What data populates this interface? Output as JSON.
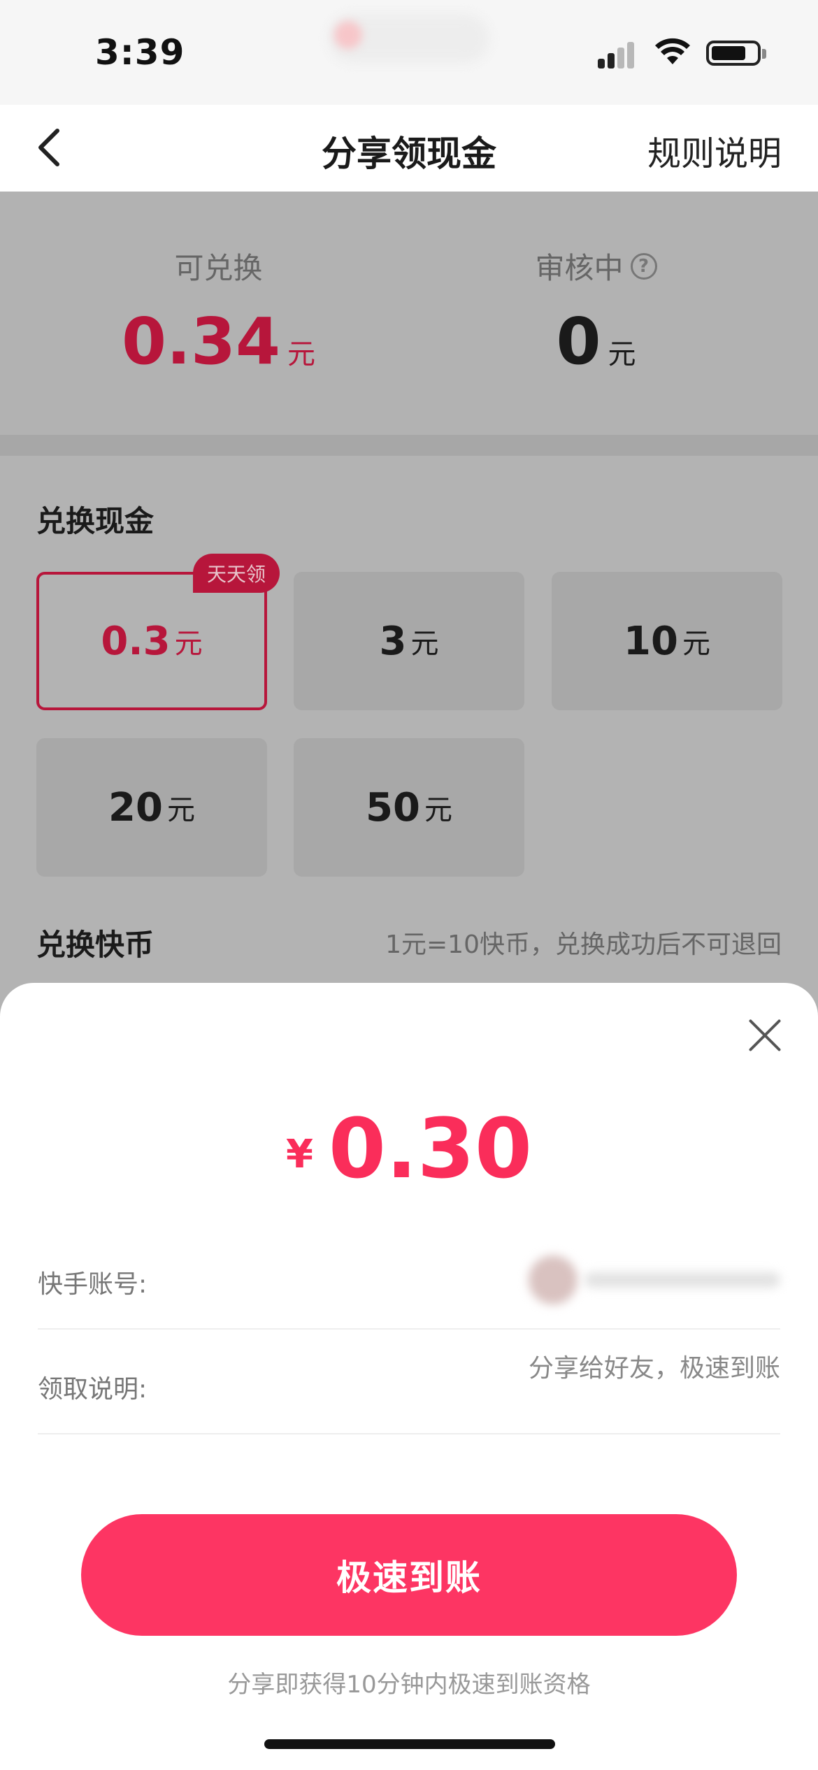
{
  "status_bar": {
    "time": "3:39"
  },
  "nav": {
    "title": "分享领现金",
    "rules": "规则说明"
  },
  "balance": {
    "available": {
      "label": "可兑换",
      "value": "0.34",
      "unit": "元"
    },
    "reviewing": {
      "label": "审核中",
      "value": "0",
      "unit": "元"
    }
  },
  "exchange": {
    "title": "兑换现金",
    "options": [
      {
        "value": "0.3",
        "unit": "元",
        "badge": "天天领",
        "selected": true
      },
      {
        "value": "3",
        "unit": "元"
      },
      {
        "value": "10",
        "unit": "元"
      },
      {
        "value": "20",
        "unit": "元"
      },
      {
        "value": "50",
        "unit": "元"
      }
    ]
  },
  "coins": {
    "title": "兑换快币",
    "note": "1元=10快币，兑换成功后不可退回"
  },
  "sheet": {
    "currency": "¥",
    "amount": "0.30",
    "account_label": "快手账号:",
    "instruction_label": "领取说明:",
    "instruction_value": "分享给好友，极速到账",
    "button": "极速到账",
    "footnote": "分享即获得10分钟内极速到账资格"
  },
  "colors": {
    "accent": "#fd3563",
    "accent_dim": "#b7163b",
    "overlay": "#b3b3b3"
  },
  "icons": {
    "back": "chevron-left-icon",
    "help": "question-circle-icon",
    "close": "close-icon"
  }
}
